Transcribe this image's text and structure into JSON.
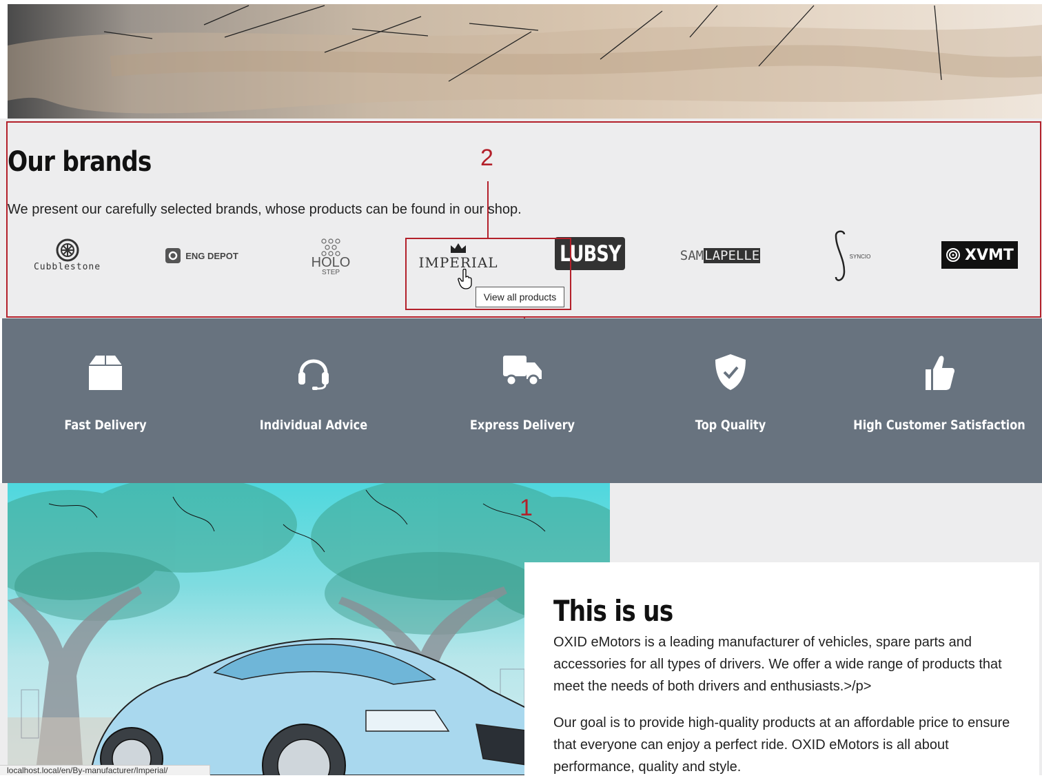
{
  "brands": {
    "title": "Our brands",
    "description": "We present our carefully selected brands, whose products can be found in our shop.",
    "tooltip": "View all products",
    "items": [
      {
        "name": "Cubblestone"
      },
      {
        "name": "ENG DEPOT"
      },
      {
        "name": "HOLO",
        "sub": "STEP"
      },
      {
        "name": "IMPERIAL"
      },
      {
        "name": "LUBSY"
      },
      {
        "name": "SAM",
        "name2": "LAPELLE"
      },
      {
        "name": "SYNCIO"
      },
      {
        "name": "XVMT"
      }
    ]
  },
  "annotations": {
    "label_1": "1",
    "label_2": "2",
    "highlight_color": "#b3202a"
  },
  "features": [
    {
      "label": "Fast Delivery",
      "icon": "box-icon"
    },
    {
      "label": "Individual Advice",
      "icon": "headset-icon"
    },
    {
      "label": "Express Delivery",
      "icon": "truck-icon"
    },
    {
      "label": "Top Quality",
      "icon": "shield-check-icon"
    },
    {
      "label": "High Customer Satisfaction",
      "icon": "thumbs-up-icon"
    }
  ],
  "about": {
    "title": "This is us",
    "paragraph1": "OXID eMotors is a leading manufacturer of vehicles, spare parts and accessories for all types of drivers. We offer a wide range of products that meet the needs of both drivers and enthusiasts.>/p>",
    "paragraph2": "Our goal is to provide high-quality products at an affordable price to ensure that everyone can enjoy a perfect ride. OXID eMotors is all about performance, quality and style."
  },
  "status_url": "localhost.local/en/By-manufacturer/Imperial/",
  "colors": {
    "feature_bg": "#68737f",
    "section_bg": "#ededee"
  }
}
